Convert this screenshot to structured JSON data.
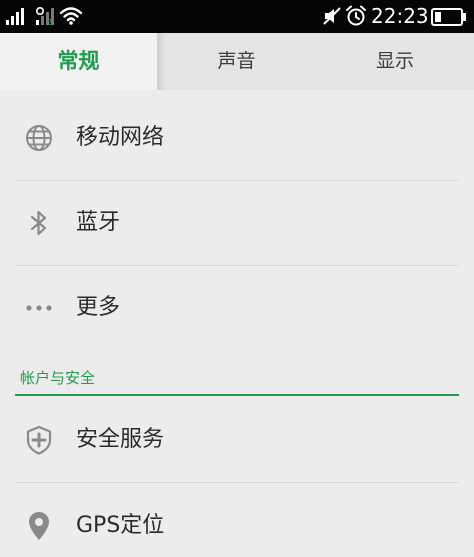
{
  "status_bar": {
    "time": "22:23",
    "icons": [
      "signal-icon",
      "signal-2-icon",
      "wifi-icon",
      "mute-icon",
      "alarm-icon",
      "battery-icon"
    ]
  },
  "tabs": [
    {
      "label": "常规",
      "active": true
    },
    {
      "label": "声音",
      "active": false
    },
    {
      "label": "显示",
      "active": false
    }
  ],
  "list": {
    "items": [
      {
        "label": "移动网络",
        "icon": "globe-icon"
      },
      {
        "label": "蓝牙",
        "icon": "bluetooth-icon"
      },
      {
        "label": "更多",
        "icon": "more-dots-icon"
      }
    ],
    "section_header": "帐户与安全",
    "section_items": [
      {
        "label": "安全服务",
        "icon": "shield-plus-icon"
      },
      {
        "label": "GPS定位",
        "icon": "location-pin-icon"
      }
    ]
  },
  "colors": {
    "accent": "#1f9d4d",
    "status_bar_bg": "#050505",
    "background": "#ececec",
    "icon_gray": "#8a8a8a"
  }
}
